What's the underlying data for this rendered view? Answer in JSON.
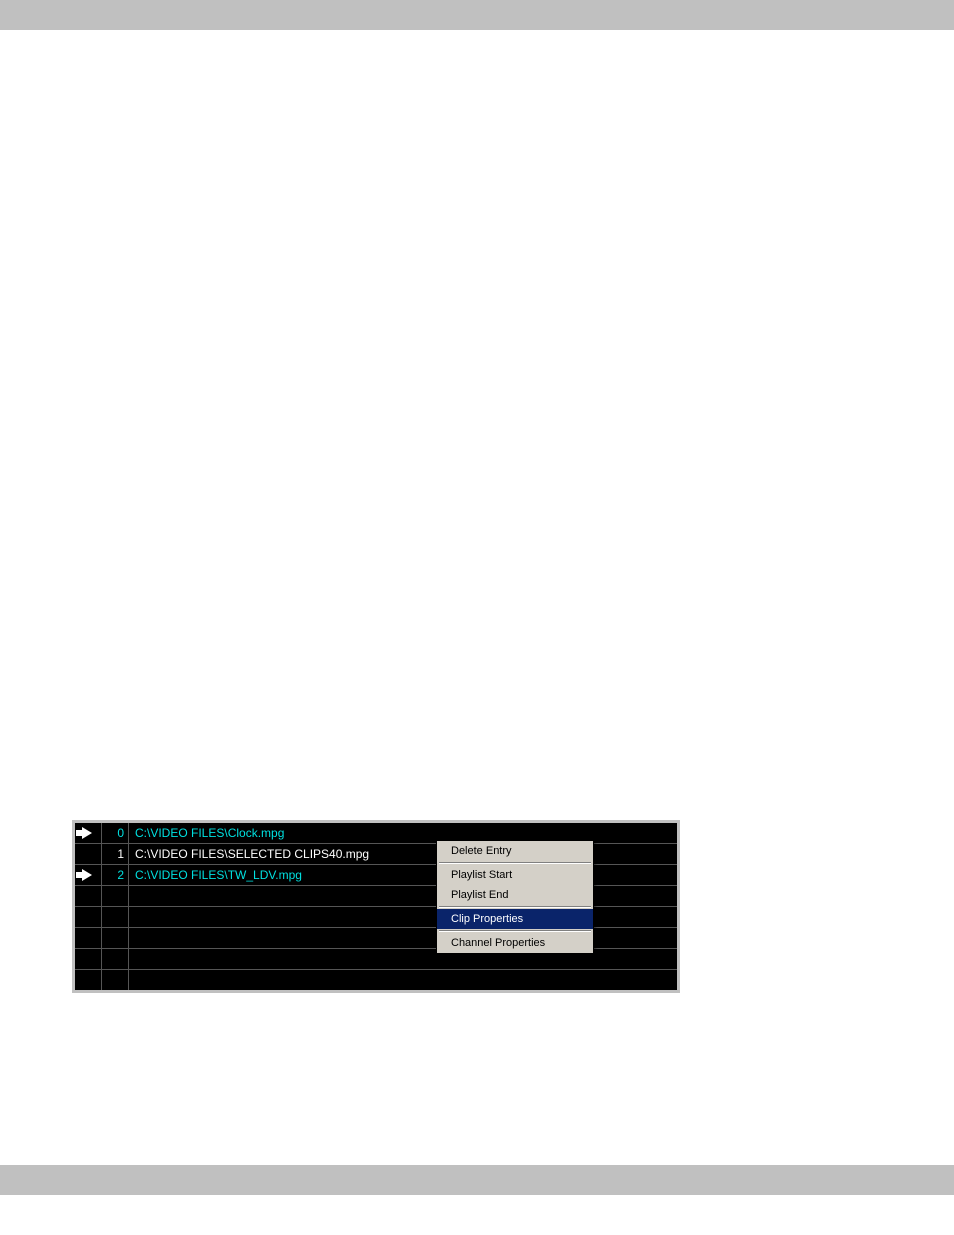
{
  "playlist": {
    "rows": [
      {
        "index": "0",
        "path": "C:\\VIDEO FILES\\Clock.mpg",
        "current": true,
        "secondary": false
      },
      {
        "index": "1",
        "path": "C:\\VIDEO FILES\\SELECTED CLIPS40.mpg",
        "current": false,
        "secondary": false
      },
      {
        "index": "2",
        "path": "C:\\VIDEO FILES\\TW_LDV.mpg",
        "current": false,
        "secondary": true
      }
    ]
  },
  "context_menu": {
    "items": [
      {
        "label": "Delete Entry",
        "selected": false
      },
      {
        "sep": true
      },
      {
        "label": "Playlist Start",
        "selected": false
      },
      {
        "label": "Playlist End",
        "selected": false
      },
      {
        "sep": true
      },
      {
        "label": "Clip Properties",
        "selected": true
      },
      {
        "sep": true
      },
      {
        "label": "Channel Properties",
        "selected": false
      }
    ]
  }
}
